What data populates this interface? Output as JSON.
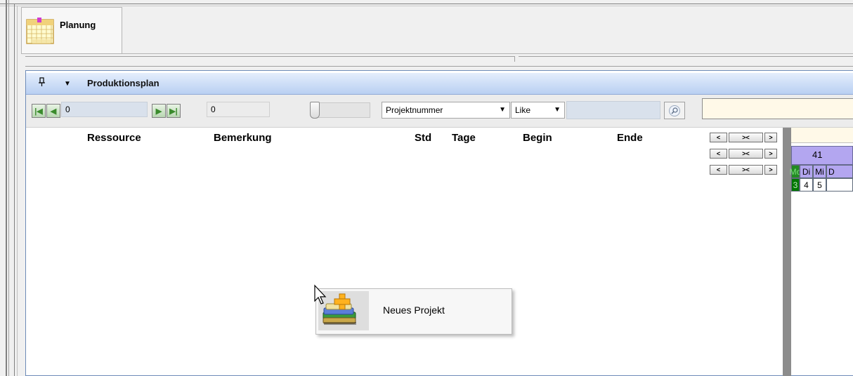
{
  "tab": {
    "label": "Planung",
    "icon": "calendar-icon"
  },
  "panel": {
    "title": "Produktionsplan",
    "pin_icon": "pin-icon",
    "collapse_icon": "chevron-down-icon"
  },
  "toolbar": {
    "position_value": "0",
    "record_value": "0",
    "field_select": "Projektnummer",
    "operator_select": "Like",
    "filter_value": "",
    "search_icon": "magnifier-icon"
  },
  "grid": {
    "columns": [
      "Ressource",
      "Bemerkung",
      "Std",
      "Tage",
      "Begin",
      "Ende"
    ]
  },
  "calendar": {
    "week": "41",
    "days": [
      "Mo",
      "Di",
      "Mi",
      "D"
    ],
    "dates": [
      "3",
      "4",
      "5",
      ""
    ],
    "colors": {
      "week": "#b3a6f0",
      "today_day": "#228b22",
      "weekday": "#b3a6f0",
      "today_date": "#007700"
    }
  },
  "scroll_buttons": {
    "left": "<",
    "middle": "><",
    "right": ">"
  },
  "context_menu": {
    "items": [
      {
        "label": "Neues Projekt",
        "icon": "new-project-icon"
      }
    ]
  }
}
